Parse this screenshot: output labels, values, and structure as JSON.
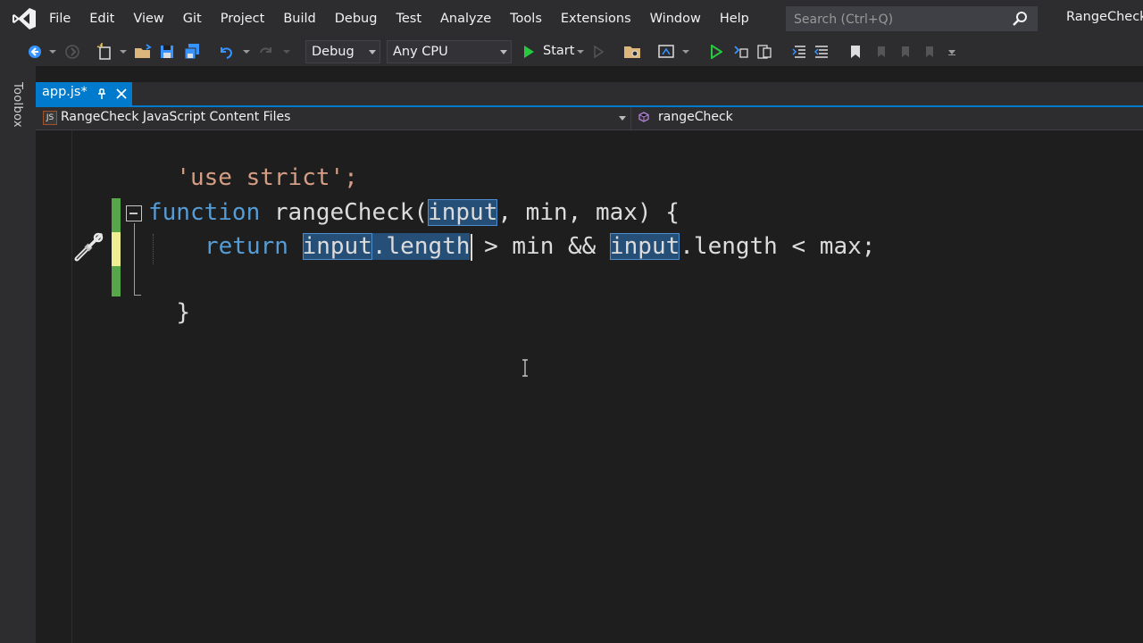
{
  "menubar": {
    "items": [
      "File",
      "Edit",
      "View",
      "Git",
      "Project",
      "Build",
      "Debug",
      "Test",
      "Analyze",
      "Tools",
      "Extensions",
      "Window",
      "Help"
    ],
    "search_placeholder": "Search (Ctrl+Q)",
    "solution_name": "RangeCheck"
  },
  "toolbar": {
    "configuration": "Debug",
    "platform": "Any CPU",
    "start_label": "Start",
    "icons": [
      "back-icon",
      "forward-icon",
      "new-project-icon",
      "open-file-icon",
      "save-icon",
      "save-all-icon",
      "undo-icon",
      "redo-icon",
      "start-icon",
      "folder-icon",
      "browser-link-icon",
      "run-without-debug-icon",
      "step-icon",
      "indent-icon",
      "comment-icon",
      "uncomment-icon",
      "bookmark-icon"
    ]
  },
  "toolbox": {
    "label": "Toolbox"
  },
  "tabs": [
    {
      "label": "app.js*",
      "active": true
    }
  ],
  "navbar": {
    "js_badge": "JS",
    "project": "RangeCheck JavaScript Content Files",
    "member": "rangeCheck"
  },
  "code": {
    "line1": "'use strict';",
    "line2": {
      "keyword": "function",
      "name": "rangeCheck",
      "open": "(",
      "param1": "input",
      "rest": ", min, max) {"
    },
    "line3": {
      "keyword": "return",
      "ref1": "input",
      "prop1": ".length",
      "mid": " > min && ",
      "ref2": "input",
      "tail": ".length < max;"
    },
    "line4": "}"
  },
  "colors": {
    "accent": "#007acc",
    "keyword": "#569cd6",
    "string": "#d69d85",
    "change_saved": "#57a64a",
    "change_unsaved": "#efef91",
    "highlight": "#264f78"
  }
}
